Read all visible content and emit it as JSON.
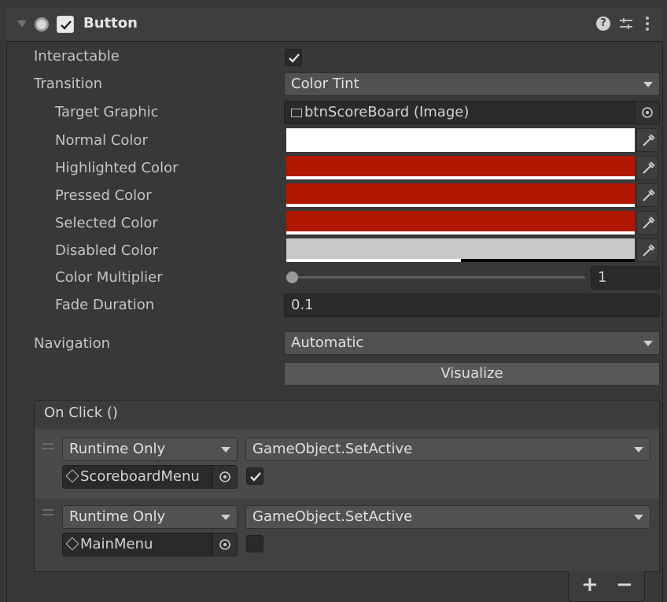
{
  "component": {
    "title": "Button",
    "enabled": true
  },
  "properties": {
    "interactable": {
      "label": "Interactable",
      "checked": true
    },
    "transition": {
      "label": "Transition",
      "value": "Color Tint"
    },
    "target_graphic": {
      "label": "Target Graphic",
      "value": "btnScoreBoard (Image)"
    },
    "normal_color": {
      "label": "Normal Color",
      "color": "#ffffff"
    },
    "highlighted_color": {
      "label": "Highlighted Color",
      "color": "#b01600"
    },
    "pressed_color": {
      "label": "Pressed Color",
      "color": "#b01600"
    },
    "selected_color": {
      "label": "Selected Color",
      "color": "#b01600"
    },
    "disabled_color": {
      "label": "Disabled Color",
      "color": "#c8c8c8",
      "alpha": 0.5
    },
    "color_multiplier": {
      "label": "Color Multiplier",
      "value": "1",
      "slider_fraction": 0.0
    },
    "fade_duration": {
      "label": "Fade Duration",
      "value": "0.1"
    },
    "navigation": {
      "label": "Navigation",
      "value": "Automatic"
    },
    "visualize_label": "Visualize"
  },
  "on_click": {
    "header": "On Click ()",
    "entries": [
      {
        "runtime": "Runtime Only",
        "function": "GameObject.SetActive",
        "object": "ScoreboardMenu",
        "checked": true
      },
      {
        "runtime": "Runtime Only",
        "function": "GameObject.SetActive",
        "object": "MainMenu",
        "checked": false
      }
    ],
    "add_label": "+",
    "remove_label": "−"
  },
  "colors": {
    "panel_bg": "#383838",
    "accent_red": "#b01600"
  }
}
